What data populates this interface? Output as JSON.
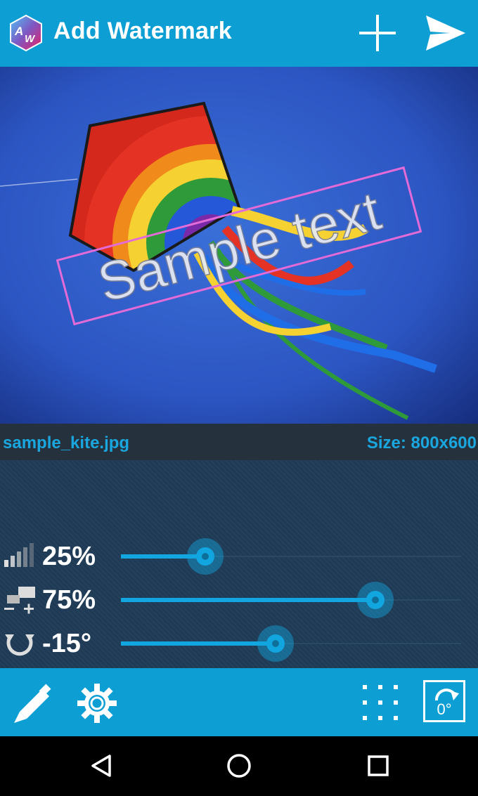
{
  "app": {
    "title": "Add Watermark",
    "logo_text": "AW"
  },
  "appbar": {
    "add_icon": "plus-icon",
    "send_icon": "send-icon"
  },
  "preview": {
    "watermark_text": "Sample text"
  },
  "info": {
    "file_name": "sample_kite.jpg",
    "image_size": "Size: 800x600"
  },
  "controls": {
    "opacity": {
      "value": "25%",
      "level": 0.25,
      "icon": "opacity-icon"
    },
    "size": {
      "value": "75%",
      "level": 0.75,
      "icon": "resize-icon"
    },
    "rotation": {
      "value": "-15°",
      "level": 0.45,
      "icon": "rotate-icon"
    }
  },
  "toolbar": {
    "edit_icon": "pencil-icon",
    "settings_icon": "gear-icon",
    "grid_icon": "position-grid-icon",
    "rotate_label": "0°"
  },
  "navbar": {
    "back_icon": "back-icon",
    "home_icon": "home-icon",
    "recents_icon": "recents-icon"
  },
  "colors": {
    "accent": "#0d9fd4",
    "slider": "#12a6e0",
    "watermark_box": "#e36bd8",
    "info_text": "#1aa7e0"
  }
}
